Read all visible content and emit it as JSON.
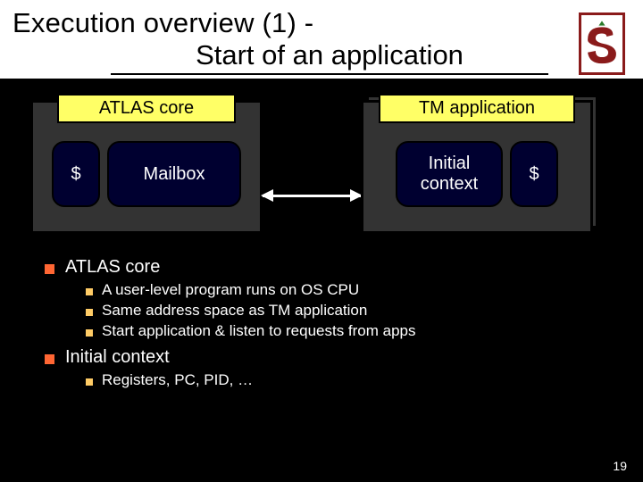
{
  "title": {
    "line1": "Execution overview (1) -",
    "line2": "Start of an application"
  },
  "diagram": {
    "left": {
      "header": "ATLAS core",
      "dollar": "$",
      "mailbox": "Mailbox"
    },
    "right": {
      "header": "TM application",
      "initial": "Initial\ncontext",
      "dollar": "$"
    }
  },
  "bullets": {
    "h1": "ATLAS core",
    "s1": "A user-level program runs on OS CPU",
    "s2": "Same address space as TM application",
    "s3": "Start application & listen to requests from apps",
    "h2": "Initial context",
    "s4": "Registers, PC, PID, …"
  },
  "page": "19"
}
